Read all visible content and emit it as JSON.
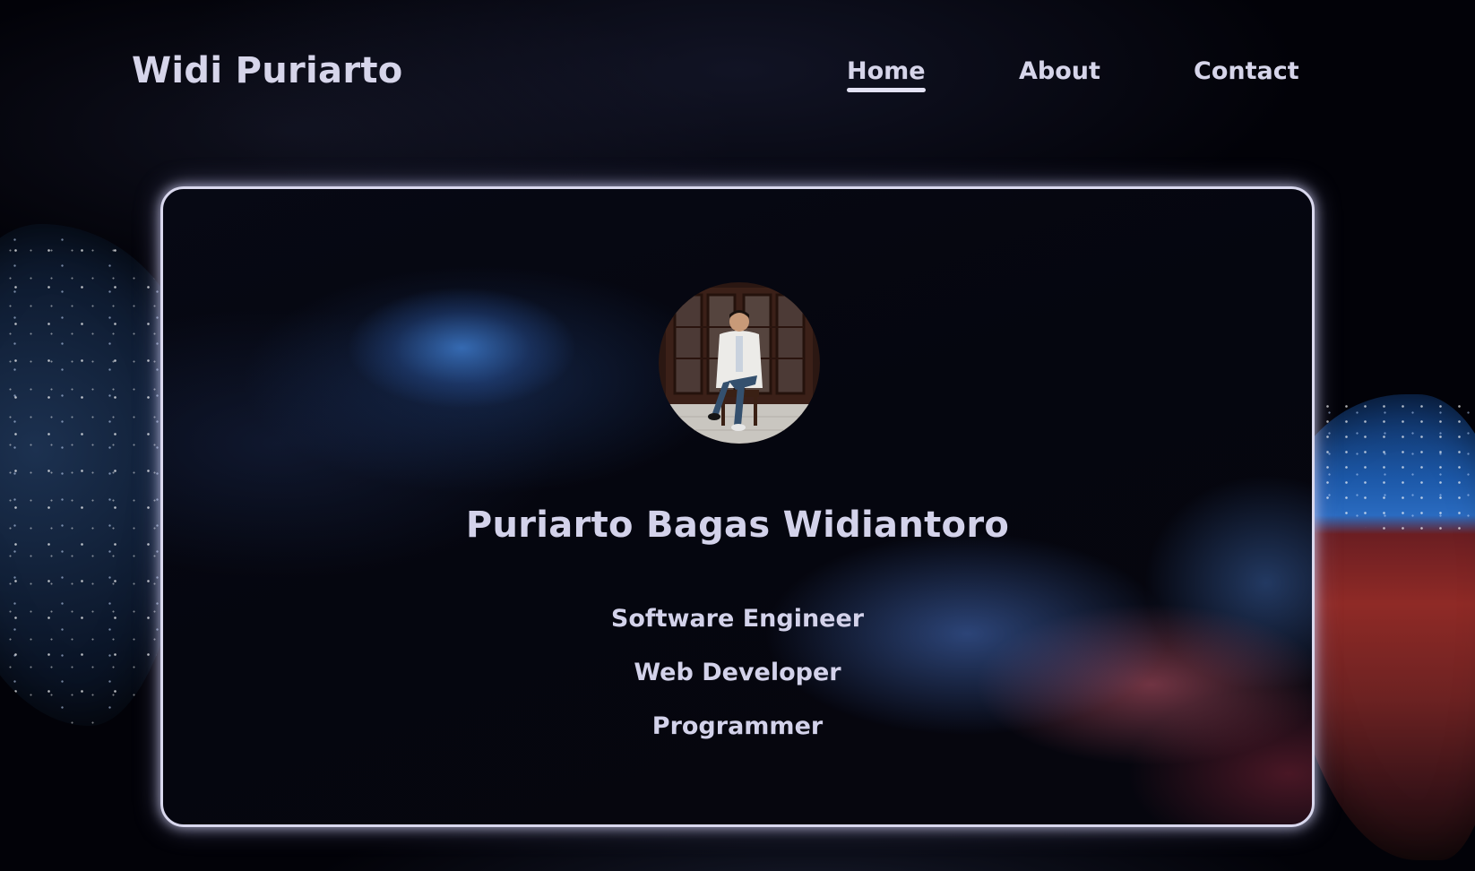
{
  "header": {
    "brand": "Widi Puriarto",
    "nav": [
      {
        "label": "Home",
        "active": true
      },
      {
        "label": "About",
        "active": false
      },
      {
        "label": "Contact",
        "active": false
      }
    ]
  },
  "hero": {
    "avatar_icon": "profile-photo",
    "name": "Puriarto Bagas Widiantoro",
    "roles": [
      "Software Engineer",
      "Web Developer",
      "Programmer"
    ]
  },
  "colors": {
    "text": "#d6d5ea",
    "background": "#02020a",
    "card_border": "#d9d8ee",
    "accent_blue": "#3c78c8",
    "accent_red": "#c85a6e"
  }
}
